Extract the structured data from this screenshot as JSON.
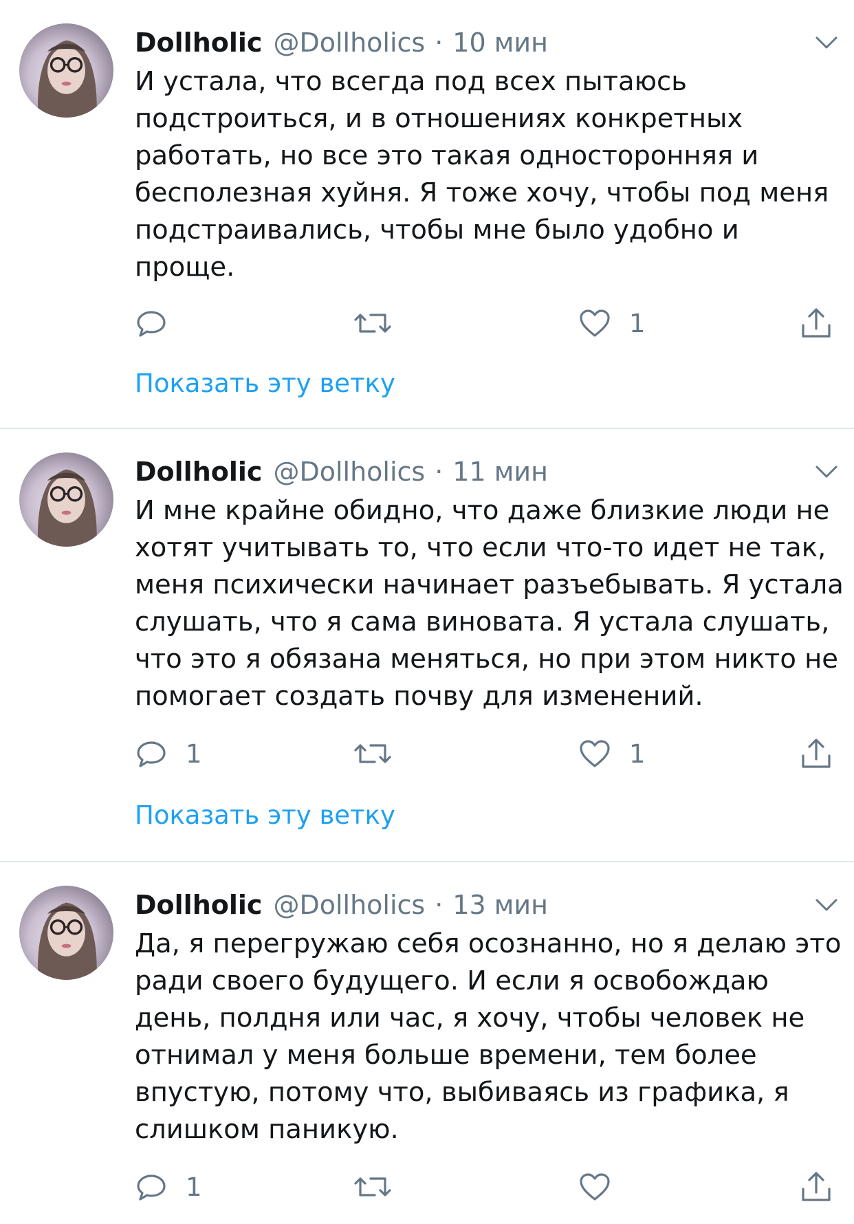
{
  "colors": {
    "accent": "#1da1f2",
    "secondary": "#657786",
    "text": "#14171a",
    "divider": "#e1e8ed"
  },
  "tweets": [
    {
      "name": "Dollholic",
      "handle": "@Dollholics",
      "separator": "·",
      "time": "10 мин",
      "lines": [
        "И устала, что всегда под всех пытаюсь",
        "подстроиться,  и в отношениях конкретных",
        "работать, но все это такая односторонняя и",
        "бесполезная хуйня. Я тоже хочу, чтобы под меня",
        "подстраивались, чтобы мне было удобно и",
        "проще."
      ],
      "replies": "",
      "likes": "1",
      "show_thread": "Показать эту ветку"
    },
    {
      "name": "Dollholic",
      "handle": "@Dollholics",
      "separator": "·",
      "time": "11 мин",
      "lines": [
        "И мне крайне обидно, что даже близкие люди не",
        "хотят учитывать то, что если что-то идет не так,",
        "меня психически начинает разъебывать. Я устала",
        "слушать, что я сама виновата. Я устала слушать,",
        "что это я обязана меняться, но при этом никто не",
        "помогает создать почву для изменений."
      ],
      "replies": "1",
      "likes": "1",
      "show_thread": "Показать эту ветку"
    },
    {
      "name": "Dollholic",
      "handle": "@Dollholics",
      "separator": "·",
      "time": "13 мин",
      "lines": [
        "Да, я перегружаю себя осознанно, но я делаю это",
        "ради своего будущего. И если я освобождаю",
        "день, полдня или час, я хочу, чтобы человек не",
        "отнимал у меня больше времени,  тем более",
        "впустую,  потому что,  выбиваясь из графика, я",
        "слишком паникую."
      ],
      "replies": "1",
      "likes": ""
    }
  ]
}
